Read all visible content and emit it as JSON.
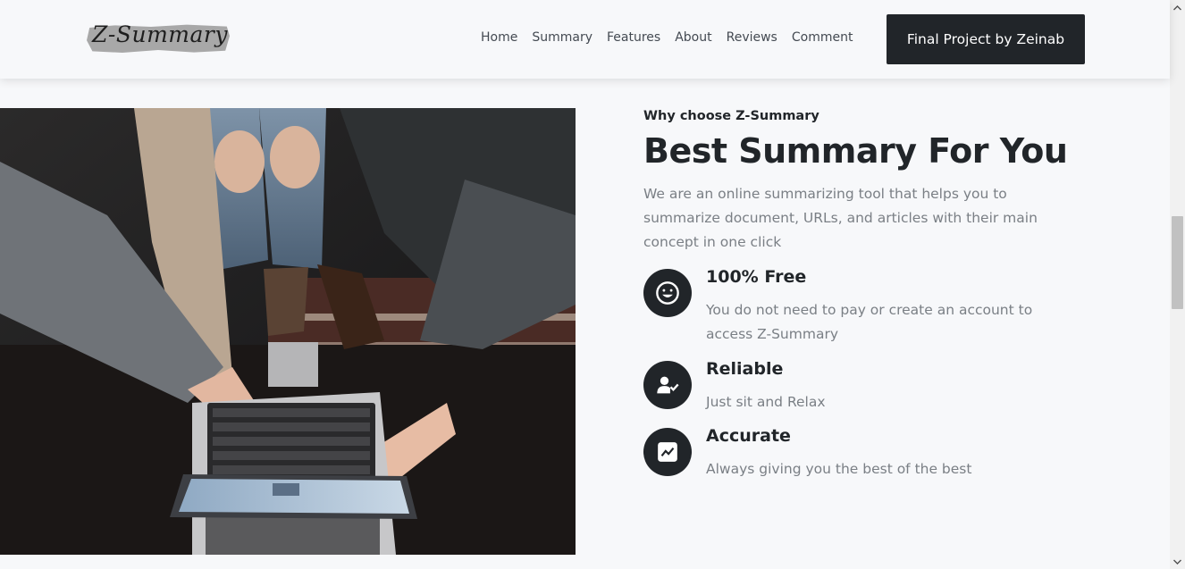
{
  "header": {
    "logo_text": "Z-Summary",
    "nav": [
      "Home",
      "Summary",
      "Features",
      "About",
      "Reviews",
      "Comment"
    ],
    "cta_label": "Final Project by Zeinab"
  },
  "hero_image": {
    "alt": "people pointing at a laptop and tablet"
  },
  "section": {
    "eyebrow": "Why choose Z-Summary",
    "title": "Best Summary For You",
    "description": "We are an online summarizing tool that helps you to summarize document, URLs, and articles with their main concept in one click",
    "features": [
      {
        "icon": "smiley-icon",
        "title": "100% Free",
        "text": "You do not need to pay or create an account to access Z-Summary"
      },
      {
        "icon": "user-check-icon",
        "title": "Reliable",
        "text": "Just sit and Relax"
      },
      {
        "icon": "chart-line-icon",
        "title": "Accurate",
        "text": "Always giving you the best of the best"
      }
    ]
  },
  "colors": {
    "dark": "#212529",
    "muted": "#7a7f85",
    "background": "#f7f8fa"
  }
}
